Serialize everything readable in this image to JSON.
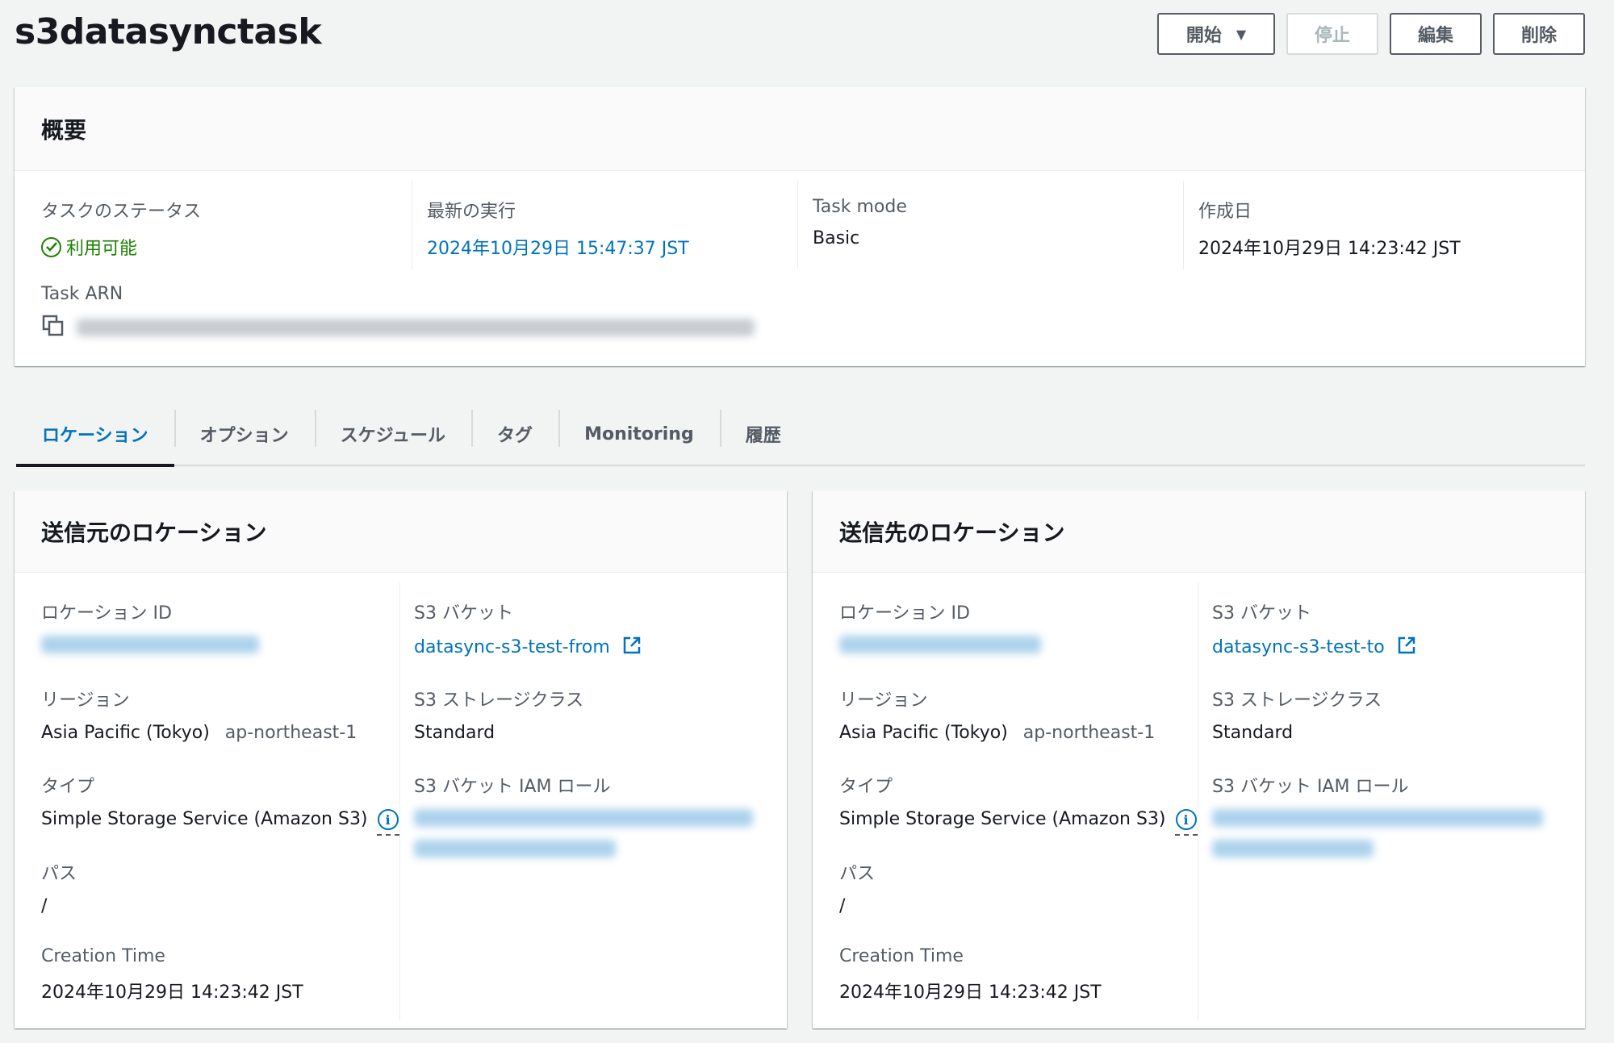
{
  "page": {
    "title": "s3datasynctask"
  },
  "actions": {
    "start_label": "開始",
    "stop_label": "停止",
    "edit_label": "編集",
    "delete_label": "削除"
  },
  "summary": {
    "heading": "概要",
    "status_label": "タスクのステータス",
    "status_value": "利用可能",
    "last_run_label": "最新の実行",
    "last_run_value": "2024年10月29日 15:47:37 JST",
    "task_mode_label": "Task mode",
    "task_mode_value": "Basic",
    "created_label": "作成日",
    "created_value": "2024年10月29日 14:23:42 JST",
    "arn_label": "Task ARN"
  },
  "tabs": [
    {
      "label": "ロケーション",
      "active": true
    },
    {
      "label": "オプション",
      "active": false
    },
    {
      "label": "スケジュール",
      "active": false
    },
    {
      "label": "タグ",
      "active": false
    },
    {
      "label": "Monitoring",
      "active": false
    },
    {
      "label": "履歴",
      "active": false
    }
  ],
  "source": {
    "heading": "送信元のロケーション",
    "location_id_label": "ロケーション ID",
    "region_label": "リージョン",
    "region_name": "Asia Pacific (Tokyo)",
    "region_code": "ap-northeast-1",
    "type_label": "タイプ",
    "type_value": "Simple Storage Service (Amazon S3)",
    "path_label": "パス",
    "path_value": "/",
    "creation_time_label": "Creation Time",
    "creation_time_value": "2024年10月29日 14:23:42 JST",
    "bucket_label": "S3 バケット",
    "bucket_value": "datasync-s3-test-from",
    "storage_class_label": "S3 ストレージクラス",
    "storage_class_value": "Standard",
    "iam_role_label": "S3 バケット IAM ロール"
  },
  "destination": {
    "heading": "送信先のロケーション",
    "location_id_label": "ロケーション ID",
    "region_label": "リージョン",
    "region_name": "Asia Pacific (Tokyo)",
    "region_code": "ap-northeast-1",
    "type_label": "タイプ",
    "type_value": "Simple Storage Service (Amazon S3)",
    "path_label": "パス",
    "path_value": "/",
    "creation_time_label": "Creation Time",
    "creation_time_value": "2024年10月29日 14:23:42 JST",
    "bucket_label": "S3 バケット",
    "bucket_value": "datasync-s3-test-to",
    "storage_class_label": "S3 ストレージクラス",
    "storage_class_value": "Standard",
    "iam_role_label": "S3 バケット IAM ロール"
  },
  "icons": {
    "status": "check-circle-icon",
    "copy": "copy-icon",
    "info": "info-icon",
    "external": "external-link-icon",
    "caret": "caret-down-icon"
  },
  "colors": {
    "link": "#0073bb",
    "success": "#1d8102",
    "background": "#f2f3f3"
  }
}
